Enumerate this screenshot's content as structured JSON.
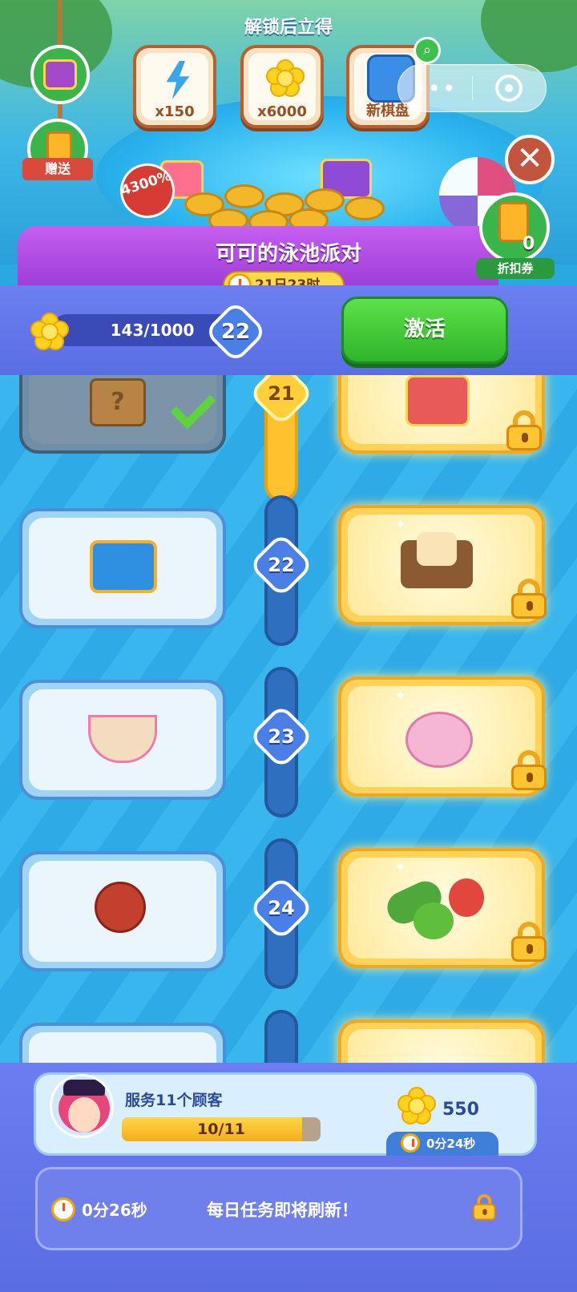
{
  "header": {
    "unlock_title": "解锁后立得",
    "rewards": [
      {
        "label": "x150",
        "icon": "energy-bolt-icon"
      },
      {
        "label": "x6000",
        "icon": "flower-coin-icon"
      },
      {
        "label": "新棋盘",
        "icon": "new-board-icon"
      }
    ],
    "send_label": "赠送",
    "discount_badge": "4300%",
    "coupon": {
      "count": "0",
      "label": "折扣券"
    }
  },
  "event": {
    "title": "可可的泳池派对",
    "time_left": "21日23时"
  },
  "progress": {
    "value": "143/1000",
    "current_level": "22",
    "activate_label": "激活"
  },
  "track": [
    {
      "level": "21",
      "free_item": "mystery-box",
      "claimed": true,
      "premium_item": "mystery-chest",
      "locked": true
    },
    {
      "level": "22",
      "free_item": "treasure-chest",
      "claimed": false,
      "premium_item": "flower-cake-tray",
      "locked": true
    },
    {
      "level": "23",
      "free_item": "ramen-bowl",
      "claimed": false,
      "premium_item": "piggy-bank",
      "locked": true
    },
    {
      "level": "24",
      "free_item": "pomegranate",
      "claimed": false,
      "premium_item": "vegetables",
      "locked": true
    }
  ],
  "task": {
    "title": "服务11个顾客",
    "progress_text": "10/11",
    "progress_fraction": 0.909,
    "reward": "550",
    "timer": "0分24秒"
  },
  "daily": {
    "timer": "0分26秒",
    "text": "每日任务即将刷新！"
  },
  "colors": {
    "banner_purple": "#b04ee6",
    "activate_green": "#3ccb35",
    "premium_gold": "#ffd25a",
    "rail_blue": "#2f6fc0"
  }
}
